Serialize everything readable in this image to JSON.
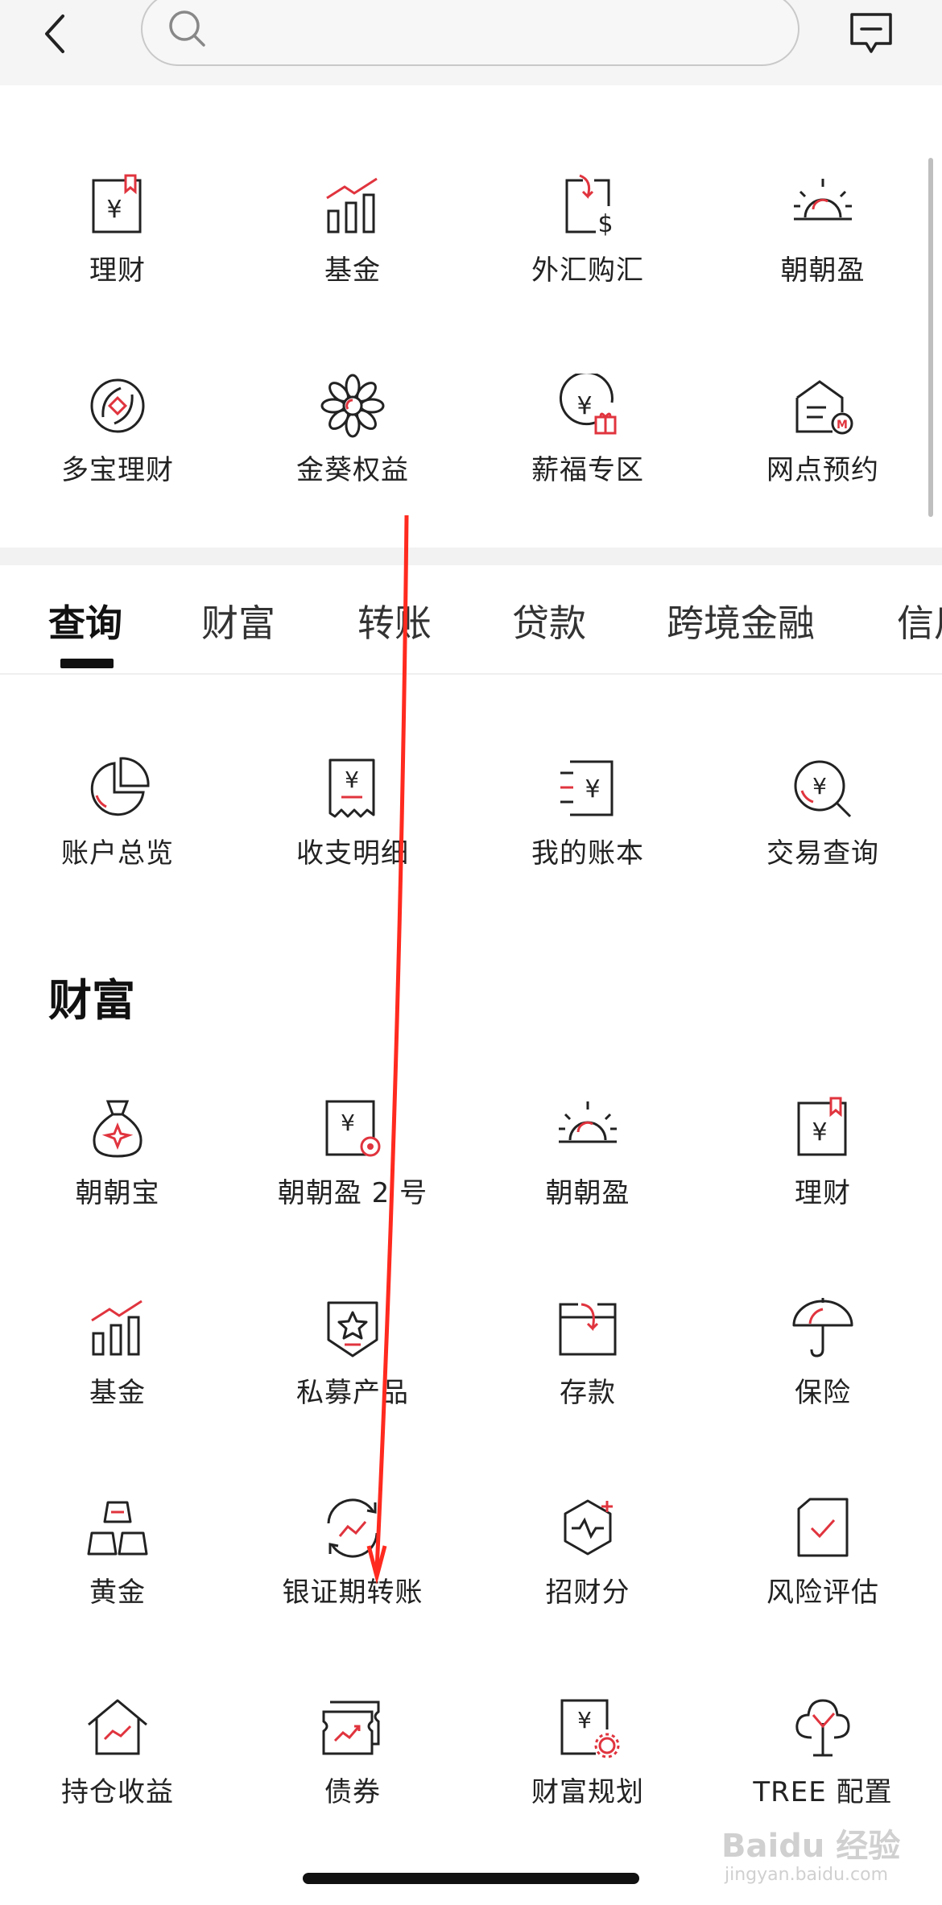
{
  "header": {
    "search_placeholder": ""
  },
  "quick": [
    {
      "label": "理财",
      "icon": "wealth-doc-icon"
    },
    {
      "label": "基金",
      "icon": "fund-chart-icon"
    },
    {
      "label": "外汇购汇",
      "icon": "forex-icon"
    },
    {
      "label": "朝朝盈",
      "icon": "sunrise-icon"
    },
    {
      "label": "多宝理财",
      "icon": "duobao-icon"
    },
    {
      "label": "金葵权益",
      "icon": "sunflower-icon"
    },
    {
      "label": "薪福专区",
      "icon": "salary-gift-icon"
    },
    {
      "label": "网点预约",
      "icon": "branch-booking-icon"
    }
  ],
  "tabs": [
    "查询",
    "财富",
    "转账",
    "贷款",
    "跨境金融",
    "信用"
  ],
  "query": [
    {
      "label": "账户总览",
      "icon": "pie-chart-icon"
    },
    {
      "label": "收支明细",
      "icon": "receipt-icon"
    },
    {
      "label": "我的账本",
      "icon": "ledger-icon"
    },
    {
      "label": "交易查询",
      "icon": "search-yuan-icon"
    }
  ],
  "wealth": {
    "title": "财富",
    "items": [
      {
        "label": "朝朝宝",
        "icon": "money-bag-icon"
      },
      {
        "label": "朝朝盈 2 号",
        "icon": "doc-target-icon"
      },
      {
        "label": "朝朝盈",
        "icon": "sunrise-icon"
      },
      {
        "label": "理财",
        "icon": "wealth-doc-icon"
      },
      {
        "label": "基金",
        "icon": "fund-chart-icon"
      },
      {
        "label": "私募产品",
        "icon": "star-shield-icon"
      },
      {
        "label": "存款",
        "icon": "deposit-icon"
      },
      {
        "label": "保险",
        "icon": "umbrella-icon"
      },
      {
        "label": "黄金",
        "icon": "gold-bars-icon"
      },
      {
        "label": "银证期转账",
        "icon": "transfer-cycle-icon"
      },
      {
        "label": "招财分",
        "icon": "hexagon-score-icon"
      },
      {
        "label": "风险评估",
        "icon": "risk-check-icon"
      },
      {
        "label": "持仓收益",
        "icon": "house-chart-icon"
      },
      {
        "label": "债券",
        "icon": "bond-icon"
      },
      {
        "label": "财富规划",
        "icon": "planning-gear-icon"
      },
      {
        "label": "TREE 配置",
        "icon": "tree-icon"
      }
    ]
  },
  "watermark": {
    "line1": "Baidu 经验",
    "line2": "jingyan.baidu.com"
  },
  "colors": {
    "accent": "#e0343e",
    "text": "#1a1a1a",
    "line": "#222222"
  }
}
